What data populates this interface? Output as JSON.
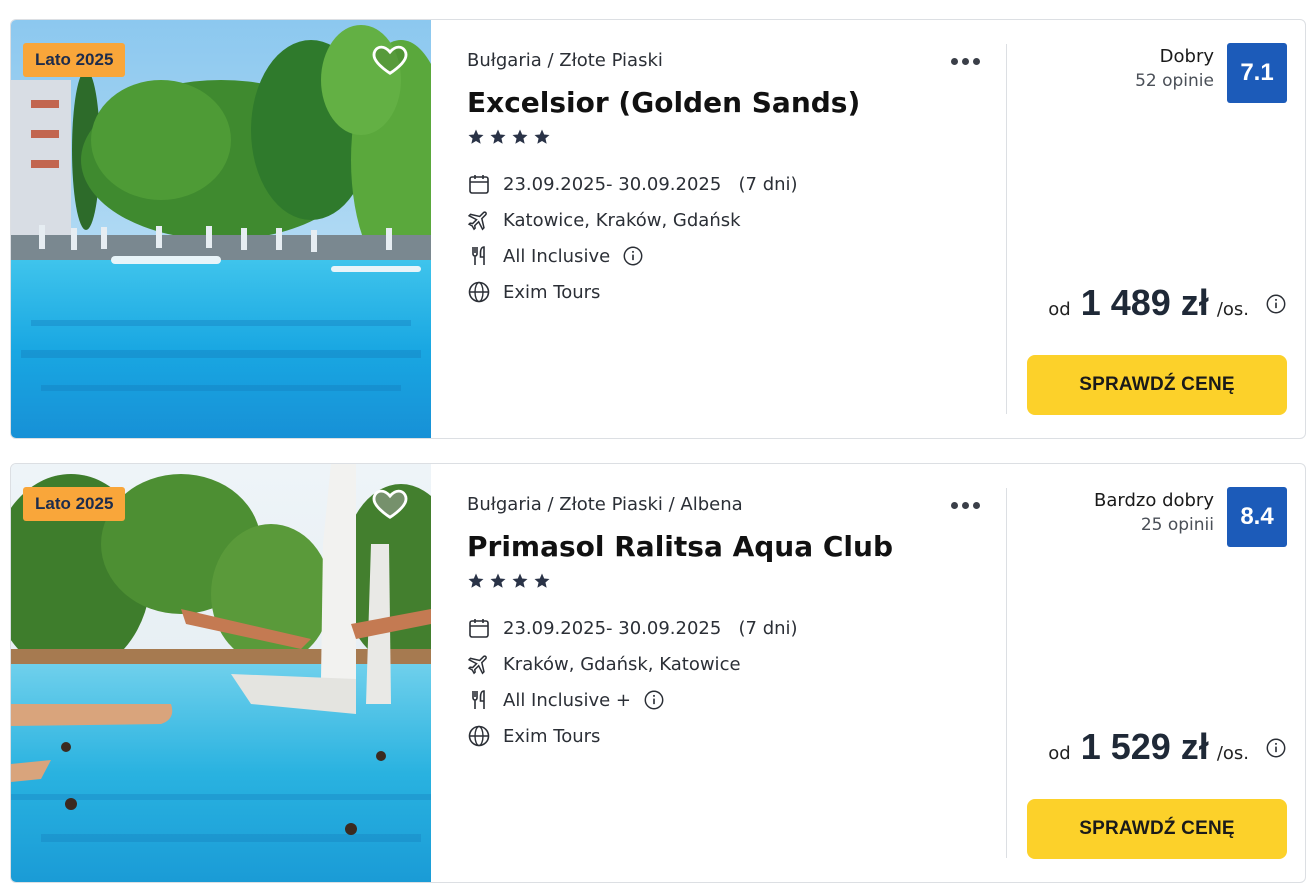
{
  "offers": [
    {
      "badge": "Lato 2025",
      "location": "Bułgaria / Złote Piaski",
      "name": "Excelsior (Golden Sands)",
      "stars": 4,
      "dates": "23.09.2025- 30.09.2025   (7 dni)",
      "airports": "Katowice, Kraków, Gdańsk",
      "board": "All Inclusive",
      "operator": "Exim Tours",
      "rating_label": "Dobry",
      "rating_count": "52 opinie",
      "rating_score": "7.1",
      "price_prefix": "od",
      "price": "1 489 zł",
      "price_suffix": "/os.",
      "cta": "SPRAWDŹ CENĘ"
    },
    {
      "badge": "Lato 2025",
      "location": "Bułgaria / Złote Piaski / Albena",
      "name": "Primasol Ralitsa Aqua Club",
      "stars": 4,
      "dates": "23.09.2025- 30.09.2025   (7 dni)",
      "airports": "Kraków, Gdańsk, Katowice",
      "board": "All Inclusive +",
      "operator": "Exim Tours",
      "rating_label": "Bardzo dobry",
      "rating_count": "25 opinii",
      "rating_score": "8.4",
      "price_prefix": "od",
      "price": "1 529 zł",
      "price_suffix": "/os.",
      "cta": "SPRAWDŹ CENĘ"
    }
  ],
  "icons": {
    "favorite": "heart-icon",
    "more": "more-dots-icon",
    "star": "star-icon",
    "dates": "calendar-icon",
    "airports": "plane-icon",
    "board": "cutlery-icon",
    "operator": "globe-icon",
    "info": "info-icon"
  },
  "colors": {
    "badge": "#f9a63a",
    "rating": "#1c5bb9",
    "cta": "#fcd12a"
  }
}
